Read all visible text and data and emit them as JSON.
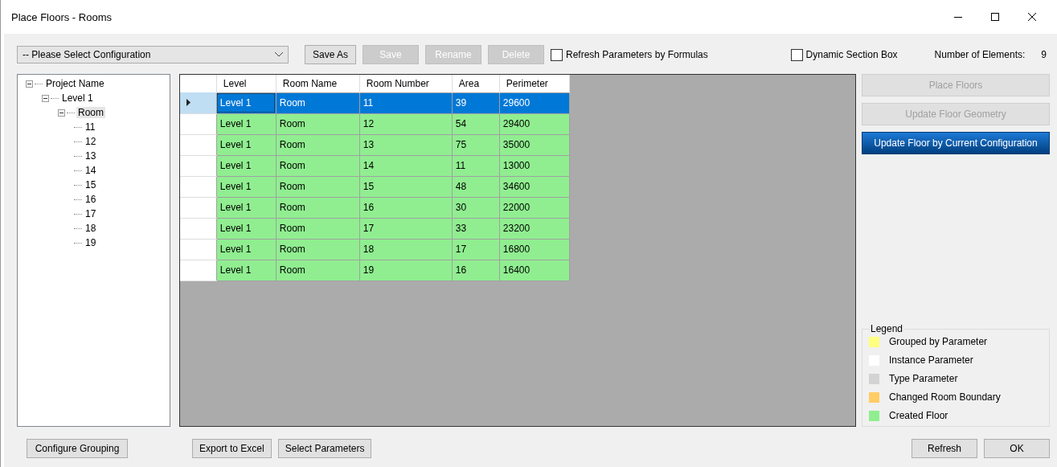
{
  "window": {
    "title": "Place Floors - Rooms"
  },
  "toolbar": {
    "configuration": {
      "value": "-- Please Select Configuration"
    },
    "buttons": [
      {
        "label": "Save As",
        "disabled": false
      },
      {
        "label": "Save",
        "disabled": true
      },
      {
        "label": "Rename",
        "disabled": true
      },
      {
        "label": "Delete",
        "disabled": true
      }
    ],
    "checkboxes": [
      {
        "label": "Refresh Parameters by Formulas",
        "checked": false
      },
      {
        "label": "Dynamic Section Box",
        "checked": false
      }
    ],
    "element_count": {
      "label": "Number of Elements:",
      "value": "9"
    }
  },
  "tree": [
    {
      "label": "Project Name",
      "expanded": true,
      "selected": false,
      "children": [
        {
          "label": "Level 1",
          "expanded": true,
          "selected": false,
          "children": [
            {
              "label": "Room",
              "expanded": true,
              "selected": true,
              "children": [
                {
                  "label": "11",
                  "selected": false
                },
                {
                  "label": "12",
                  "selected": false
                },
                {
                  "label": "13",
                  "selected": false
                },
                {
                  "label": "14",
                  "selected": false
                },
                {
                  "label": "15",
                  "selected": false
                },
                {
                  "label": "16",
                  "selected": false
                },
                {
                  "label": "17",
                  "selected": false
                },
                {
                  "label": "18",
                  "selected": false
                },
                {
                  "label": "19",
                  "selected": false
                }
              ]
            }
          ]
        }
      ]
    }
  ],
  "table": {
    "columns": [
      "Level",
      "Room Name",
      "Room Number",
      "Area",
      "Perimeter"
    ],
    "rows": [
      {
        "cells": [
          "Level 1",
          "Room",
          "11",
          "39",
          "29600"
        ],
        "selected": true
      },
      {
        "cells": [
          "Level 1",
          "Room",
          "12",
          "54",
          "29400"
        ],
        "selected": false
      },
      {
        "cells": [
          "Level 1",
          "Room",
          "13",
          "75",
          "35000"
        ],
        "selected": false
      },
      {
        "cells": [
          "Level 1",
          "Room",
          "14",
          "11",
          "13000"
        ],
        "selected": false
      },
      {
        "cells": [
          "Level 1",
          "Room",
          "15",
          "48",
          "34600"
        ],
        "selected": false
      },
      {
        "cells": [
          "Level 1",
          "Room",
          "16",
          "30",
          "22000"
        ],
        "selected": false
      },
      {
        "cells": [
          "Level 1",
          "Room",
          "17",
          "33",
          "23200"
        ],
        "selected": false
      },
      {
        "cells": [
          "Level 1",
          "Room",
          "18",
          "17",
          "16800"
        ],
        "selected": false
      },
      {
        "cells": [
          "Level 1",
          "Room",
          "19",
          "16",
          "16400"
        ],
        "selected": false
      }
    ]
  },
  "actions": [
    {
      "label": "Place Floors",
      "disabled": true,
      "primary": false
    },
    {
      "label": "Update Floor Geometry",
      "disabled": true,
      "primary": false
    },
    {
      "label": "Update Floor by Current Configuration",
      "disabled": false,
      "primary": true
    }
  ],
  "legend": {
    "title": "Legend",
    "items": [
      {
        "label": "Grouped by Parameter",
        "color": "#ffff80"
      },
      {
        "label": "Instance Parameter",
        "color": "#ffffff"
      },
      {
        "label": "Type Parameter",
        "color": "#d3d3d3"
      },
      {
        "label": "Changed Room Boundary",
        "color": "#ffcc66"
      },
      {
        "label": "Created Floor",
        "color": "#90ee90"
      }
    ]
  },
  "bottom": {
    "left": [
      {
        "label": "Configure Grouping"
      }
    ],
    "middle": [
      {
        "label": "Export to Excel"
      },
      {
        "label": "Select Parameters"
      }
    ],
    "right": [
      {
        "label": "Refresh"
      },
      {
        "label": "OK"
      }
    ]
  }
}
